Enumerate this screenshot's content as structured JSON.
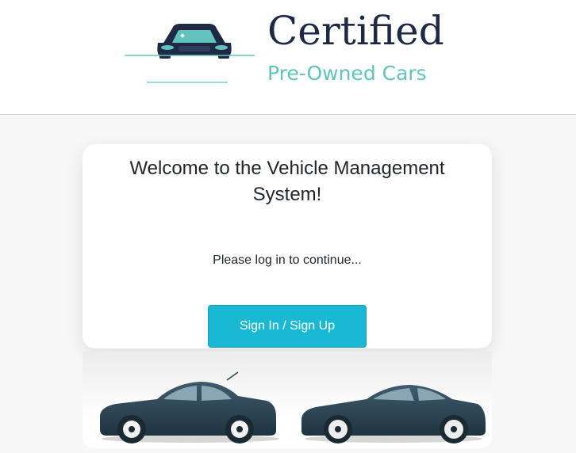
{
  "header": {
    "logo": {
      "title": "Certified",
      "subtitle": "Pre-Owned Cars",
      "icon": "car-icon"
    }
  },
  "card": {
    "title": "Welcome to the Vehicle Management System!",
    "message": "Please log in to continue...",
    "button_label": "Sign In / Sign Up"
  },
  "banner": {
    "icons": [
      "sedan-car-icon",
      "sports-car-icon"
    ]
  },
  "colors": {
    "brand_navy": "#1e2a44",
    "brand_teal": "#62c3bd",
    "button": "#1ab9d3",
    "car_body": "#2b4251"
  }
}
